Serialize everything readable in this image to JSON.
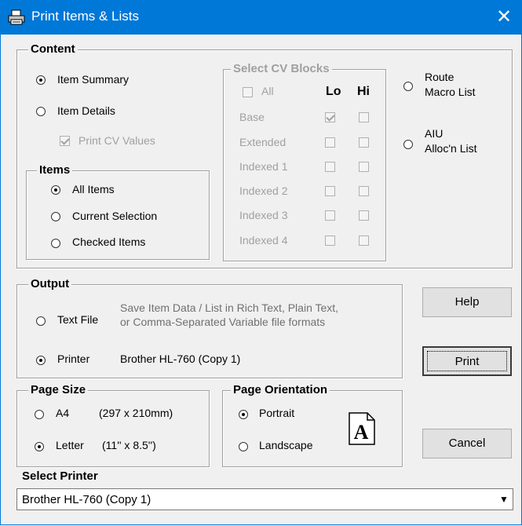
{
  "window": {
    "title": "Print Items & Lists",
    "close_label": "✕"
  },
  "content": {
    "legend": "Content",
    "item_summary": "Item Summary",
    "item_details": "Item Details",
    "print_cv_values": "Print CV Values"
  },
  "items_group": {
    "legend": "Items",
    "all_items": "All Items",
    "current_selection": "Current Selection",
    "checked_items": "Checked Items"
  },
  "cv_blocks": {
    "legend": "Select CV Blocks",
    "all": "All",
    "lo": "Lo",
    "hi": "Hi",
    "rows": [
      "Base",
      "Extended",
      "Indexed 1",
      "Indexed 2",
      "Indexed 3",
      "Indexed 4"
    ]
  },
  "route": {
    "line1": "Route",
    "line2": "Macro List"
  },
  "aiu": {
    "line1": "AIU",
    "line2": "Alloc'n List"
  },
  "output": {
    "legend": "Output",
    "text_file": "Text File",
    "text_desc1": "Save Item Data / List in Rich Text, Plain Text,",
    "text_desc2": "or Comma-Separated Variable file formats",
    "printer": "Printer",
    "printer_name": "Brother HL-760 (Copy 1)"
  },
  "page_size": {
    "legend": "Page Size",
    "a4": "A4",
    "a4_dims": "(297 x 210mm)",
    "letter": "Letter",
    "letter_dims": "(11'' x 8.5'')"
  },
  "orientation": {
    "legend": "Page Orientation",
    "portrait": "Portrait",
    "landscape": "Landscape",
    "icon_letter": "A"
  },
  "buttons": {
    "help": "Help",
    "print": "Print",
    "cancel": "Cancel"
  },
  "select_printer": {
    "label": "Select Printer",
    "value": "Brother HL-760 (Copy 1)"
  },
  "colors": {
    "titlebar": "#0078d7",
    "background": "#f0f0f0",
    "disabled": "#a0a0a0"
  }
}
